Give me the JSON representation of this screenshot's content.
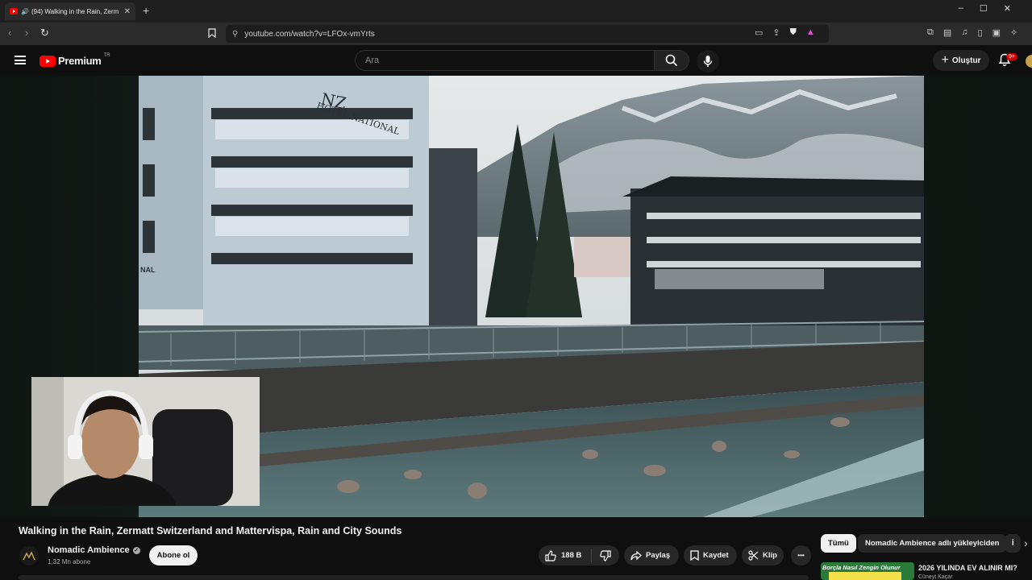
{
  "browser": {
    "tab_title": "(94) Walking in the Rain, Zerm",
    "new_tab": "+",
    "url": "youtube.com/watch?v=LFOx-vmYrts",
    "window_controls": [
      "–",
      "☐",
      "✕"
    ]
  },
  "header": {
    "logo_text": "Premium",
    "country": "TR",
    "search_placeholder": "Ara",
    "create_label": "Oluştur",
    "notif_count": "9+"
  },
  "video": {
    "scene_hotel_sign": "HOTEL NATIONAL",
    "scene_hotel_logo": "NZ",
    "scene_wall_sign": "NAL"
  },
  "watch": {
    "title": "Walking in the Rain, Zermatt Switzerland and Mattervispa, Rain and City Sounds",
    "channel": "Nomadic Ambience",
    "subscribers": "1,32 Mn abone",
    "subscribe_label": "Abone ol",
    "likes": "188 B",
    "share_label": "Paylaş",
    "save_label": "Kaydet",
    "clip_label": "Klip",
    "more": "•••"
  },
  "sidebar": {
    "chips": [
      "Tümü",
      "Nomadic Ambience adlı yükleyiciden",
      "İ"
    ],
    "next_arrow": "›",
    "rec_thumb_text": "Borçla Nasıl Zengin Olunur",
    "rec_title": "2026 YILINDA EV ALINIR MI?",
    "rec_channel": "Cüneyt Kaçar"
  },
  "colors": {
    "accent": "#ff0000",
    "background": "#0f0f0f",
    "pill": "#272727"
  }
}
